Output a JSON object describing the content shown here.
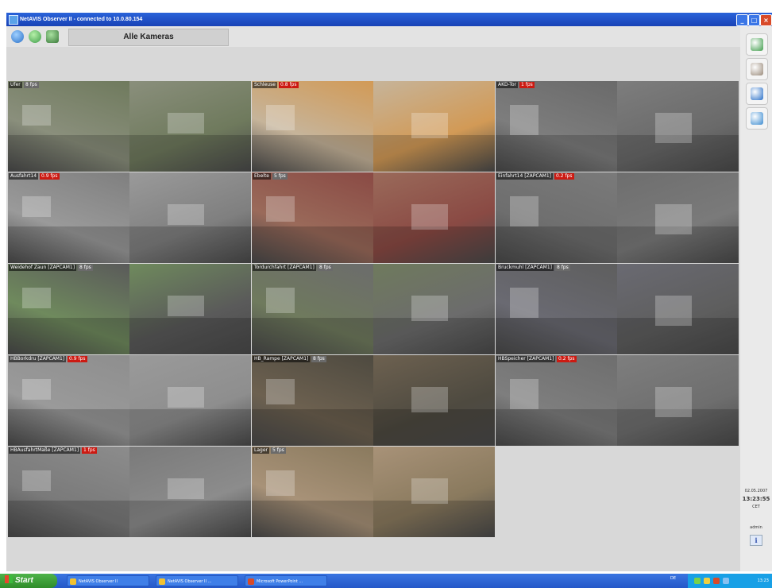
{
  "window": {
    "title": "NetAVIS Observer II  -  connected to 10.0.80.154",
    "min_label": "_",
    "max_label": "□",
    "close_label": "×"
  },
  "toolbar": {
    "view_label": "Alle Kameras"
  },
  "cameras": [
    {
      "label": "Ufer",
      "fps": "8 fps",
      "fps_alert": false,
      "colors": [
        "#6f7a5d",
        "#8a8f7c"
      ]
    },
    {
      "label": "Schleuse",
      "fps": "0.8 fps",
      "fps_alert": true,
      "colors": [
        "#d29a56",
        "#c6b49a"
      ]
    },
    {
      "label": "AKD-Tor",
      "fps": "1 fps",
      "fps_alert": true,
      "colors": [
        "#6a6a6a",
        "#7d7d7d"
      ]
    },
    {
      "label": "Ausfahrt14",
      "fps": "0.9 fps",
      "fps_alert": true,
      "colors": [
        "#7f7f7f",
        "#9a9a9a"
      ]
    },
    {
      "label": "Ebelte",
      "fps": "5 fps",
      "fps_alert": false,
      "colors": [
        "#8a4a44",
        "#9a6a5a"
      ]
    },
    {
      "label": "Einfahrt14 [ZAPCAM1]",
      "fps": "0.2 fps",
      "fps_alert": true,
      "colors": [
        "#7a7a7a",
        "#6e6e6e"
      ]
    },
    {
      "label": "Weidehof Zaun [ZAPCAM1]",
      "fps": "8 fps",
      "fps_alert": false,
      "colors": [
        "#5a5a5a",
        "#6f8a5d"
      ]
    },
    {
      "label": "Tordurchfahrt [ZAPCAM1]",
      "fps": "8 fps",
      "fps_alert": false,
      "colors": [
        "#6c6c6c",
        "#6f7a5d"
      ]
    },
    {
      "label": "Bruckmuhl [ZAPCAM1]",
      "fps": "8 fps",
      "fps_alert": false,
      "colors": [
        "#5e5e5e",
        "#6a6a72"
      ]
    },
    {
      "label": "HBBorkdru [ZAPCAM1]",
      "fps": "0.9 fps",
      "fps_alert": true,
      "colors": [
        "#8e8e8e",
        "#9a9a9a"
      ]
    },
    {
      "label": "HB_Rampe [ZAPCAM1]",
      "fps": "8 fps",
      "fps_alert": false,
      "colors": [
        "#4e4a40",
        "#6d6150"
      ]
    },
    {
      "label": "HBSpeicher [ZAPCAM1]",
      "fps": "0.2 fps",
      "fps_alert": true,
      "colors": [
        "#6e6e6e",
        "#7e7e7e"
      ]
    },
    {
      "label": "HBAusfahrtMaße [ZAPCAM1]",
      "fps": "1 fps",
      "fps_alert": true,
      "colors": [
        "#8c8c8c",
        "#7a7a7a"
      ]
    },
    {
      "label": "Lager",
      "fps": "5 fps",
      "fps_alert": false,
      "colors": [
        "#8a7a5e",
        "#a89278"
      ]
    }
  ],
  "sidebar": {
    "buttons": [
      {
        "name": "monitor-icon",
        "color": "#3e9c4a"
      },
      {
        "name": "camera-settings-icon",
        "color": "#9a8a7a"
      },
      {
        "name": "edit-icon",
        "color": "#2a70c8"
      },
      {
        "name": "users-icon",
        "color": "#3a8ad0"
      }
    ],
    "date": "02.05.2007",
    "time": "13:23:55",
    "timezone": "CET",
    "user": "admin",
    "info_label": "i"
  },
  "taskbar": {
    "start_label": "Start",
    "tasks": [
      "NetAVIS Observer II",
      "NetAVIS Observer II ...",
      "Microsoft PowerPoint ..."
    ],
    "language": "DE",
    "clock": "13:23"
  },
  "colors": {
    "fps_alert": "#cc1a12",
    "fps_normal": "#6a6a6a",
    "titlebar": "#2a63d9"
  }
}
